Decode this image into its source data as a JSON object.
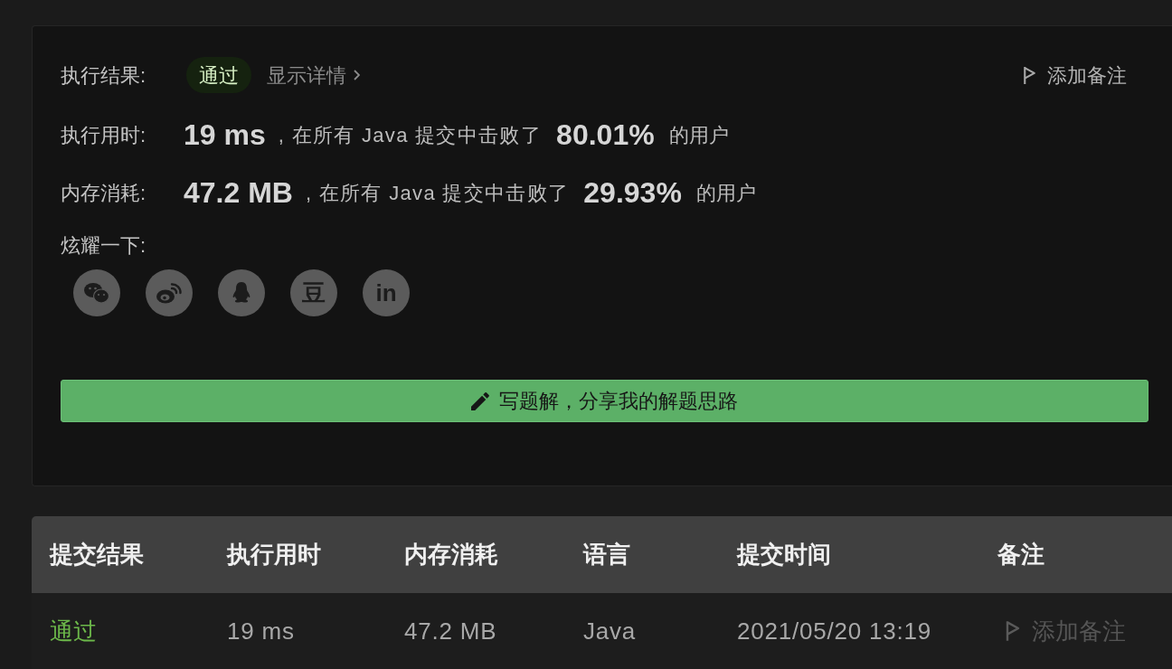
{
  "result_panel": {
    "result_row": {
      "label": "执行结果:",
      "status": {
        "text": "通过",
        "kind": "accepted"
      },
      "details_link": "显示详情"
    },
    "add_note_button": "添加备注",
    "stats": [
      {
        "label": "执行用时:",
        "value": "19 ms",
        "comparison": ", 在所有 Java 提交中击败了",
        "percentile": "80.01%",
        "suffix": "的用户"
      },
      {
        "label": "内存消耗:",
        "value": "47.2 MB",
        "comparison": ", 在所有 Java 提交中击败了",
        "percentile": "29.93%",
        "suffix": "的用户"
      }
    ],
    "share": {
      "label": "炫耀一下:",
      "buttons": [
        {
          "kind": "chat"
        },
        {
          "kind": "bird"
        },
        {
          "kind": "penguin"
        },
        {
          "kind": "text",
          "text": "豆"
        },
        {
          "kind": "text",
          "text": "in"
        }
      ]
    },
    "write_solution_button": "写题解，分享我的解题思路"
  },
  "submissions_table": {
    "columns": [
      "提交结果",
      "执行用时",
      "内存消耗",
      "语言",
      "提交时间",
      "备注"
    ],
    "rows": [
      {
        "status": {
          "text": "通过",
          "kind": "accepted"
        },
        "runtime": "19 ms",
        "memory": "47.2 MB",
        "language": "Java",
        "submitted_at": "2021/05/20 13:19",
        "note": "添加备注"
      }
    ]
  }
}
